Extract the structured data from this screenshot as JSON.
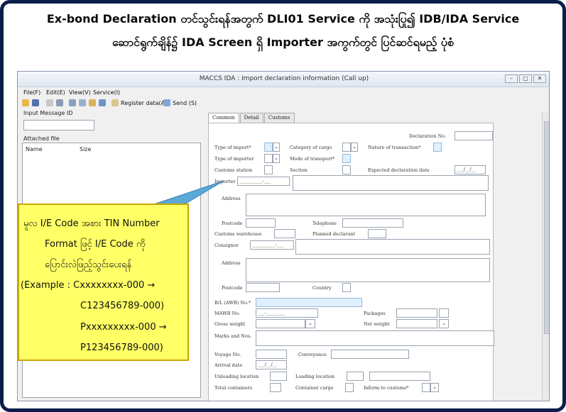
{
  "heading": {
    "line1": "Ex-bond Declaration တင်သွင်းရန်အတွက် DLI01 Service ကို အသုံးပြု၍  IDB/IDA Service",
    "line2": "ဆောင်ရွက်ချိန်၌ IDA Screen ရှိ Importer အကွက်တွင် ပြင်ဆင်ရမည့် ပုံစံ"
  },
  "window": {
    "title": "MACCS IDA : Import declaration information (Call up)",
    "controls": [
      "–",
      "▢",
      "✕"
    ]
  },
  "menu": [
    "File(F)",
    "Edit(E)",
    "View(V)",
    "Service(I)"
  ],
  "toolbar": {
    "register": "Register data(A)",
    "send": "Send (S)"
  },
  "left": {
    "input_message_id_label": "Input Message ID",
    "attached_file_label": "Attached file",
    "col_name": "Name",
    "col_size": "Size"
  },
  "tabs": [
    "Common",
    "Detail",
    "Customs"
  ],
  "form": {
    "declaration_no": "Declaration No.",
    "type_of_import": "Type of import*",
    "category_of_cargo": "Category of cargo",
    "nature_of_transaction": "Nature of transaction*",
    "type_of_importer": "Type of importer",
    "mode_of_transport": "Mode of transport*",
    "customs_station": "Customs station",
    "section": "Section",
    "expected_declaration_date": "Expected declaration date",
    "date_placeholder": "___/__/__",
    "importer": "Importer",
    "importer_code": "__________-___",
    "address": "Address",
    "postcode": "Postcode",
    "telephone": "Telephone",
    "customs_warehouse": "Customs warehouse",
    "planned_declarant": "Planned declarant",
    "consignor": "Consignor",
    "consignor_code": "__________-___",
    "address2": "Address",
    "postcode2": "Postcode",
    "country": "Country",
    "bl_no": "B/L (AWB) No.*",
    "mawb_no": "MAWB No.",
    "mawb_code": "___-________",
    "packages": "Packages",
    "gross_weight": "Gross weight",
    "net_weight": "Net weight",
    "marks_and_nos": "Marks and Nos.",
    "voyage_no": "Voyage No.",
    "conveyance": "Conveyance",
    "arrival_date": "Arrival date",
    "arrival_placeholder": "___/__/__",
    "unloading_location": "Unloading location",
    "loading_location": "Loading location",
    "total_containers": "Total containers",
    "container_cargo": "Container cargo",
    "inform_to_customs": "Inform to customs*"
  },
  "callout": {
    "lines": [
      "မူလ I/E Code အစား TIN Number",
      "Format ဖြင့် I/E Code ကို",
      "ပြောင်းလဲဖြည့်သွင်းပေးရန်",
      "(Example :  Cxxxxxxxx-000 →",
      "C123456789-000)",
      "Pxxxxxxxxx-000 →",
      "P123456789-000)"
    ]
  },
  "colors": {
    "frame": "#0b1d4a",
    "callout_fill": "#ffff66",
    "callout_border": "#c9a800",
    "pointer_fill": "#5aa9d6",
    "input_highlight": "#dff0ff"
  }
}
